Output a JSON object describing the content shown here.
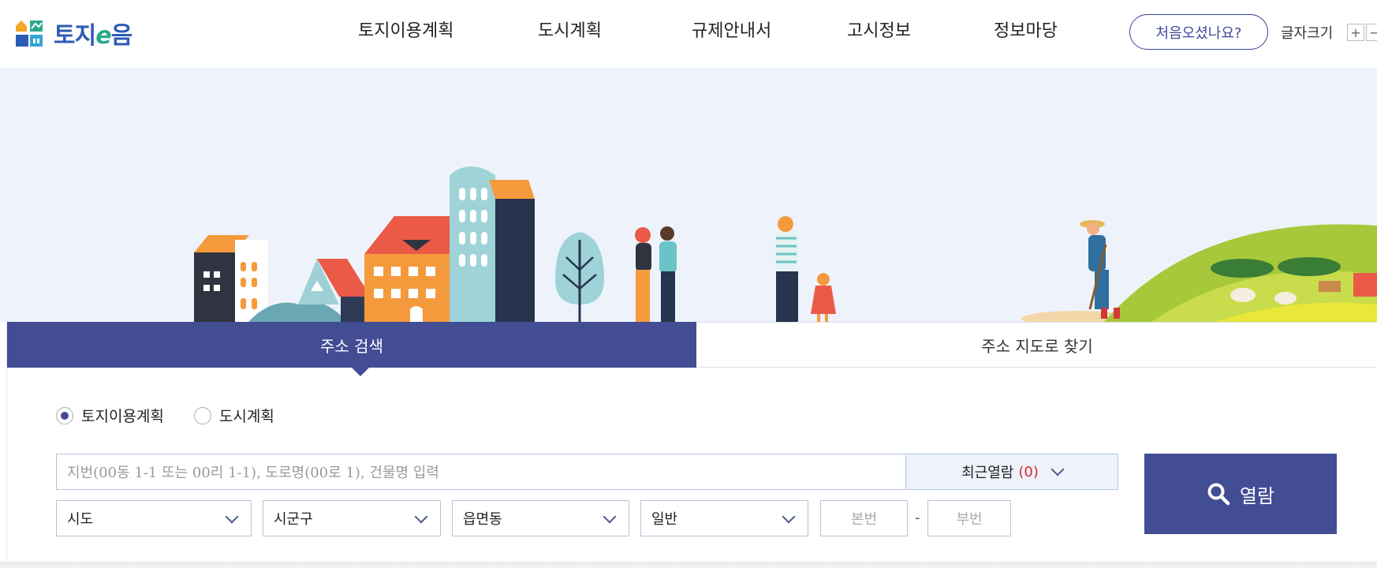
{
  "header": {
    "logo_text_a": "토지",
    "logo_text_e": "e",
    "logo_text_b": "음",
    "nav": [
      {
        "label": "토지이용계획"
      },
      {
        "label": "도시계획"
      },
      {
        "label": "규제안내서"
      },
      {
        "label": "고시정보"
      },
      {
        "label": "정보마당"
      }
    ],
    "first_visit_button": "처음오셨나요?",
    "font_size_label": "글자크기",
    "font_plus": "+",
    "font_minus": "−"
  },
  "tabs": {
    "address_search": "주소 검색",
    "map_search": "주소 지도로 찾기"
  },
  "radios": [
    {
      "label": "토지이용계획",
      "checked": true
    },
    {
      "label": "도시계획",
      "checked": false
    }
  ],
  "search": {
    "placeholder": "지번(00동 1-1 또는 00리 1-1), 도로명(00로 1), 건물명 입력",
    "recent_label": "최근열람",
    "recent_count": "(0)",
    "view_button": "열람"
  },
  "selects": {
    "sido": "시도",
    "sigungu": "시군구",
    "eupmyeondong": "읍면동",
    "type": "일반"
  },
  "lot_numbers": {
    "main_placeholder": "본번",
    "dash": "-",
    "sub_placeholder": "부번"
  },
  "colors": {
    "brand": "#424d94",
    "hero_bg": "#eef3fb",
    "logo_blue": "#2d5bb5",
    "logo_green": "#2aa98a",
    "count_red": "#d62b2b"
  },
  "icons": [
    "logo-mark-icon",
    "chevron-down-icon",
    "search-icon"
  ]
}
